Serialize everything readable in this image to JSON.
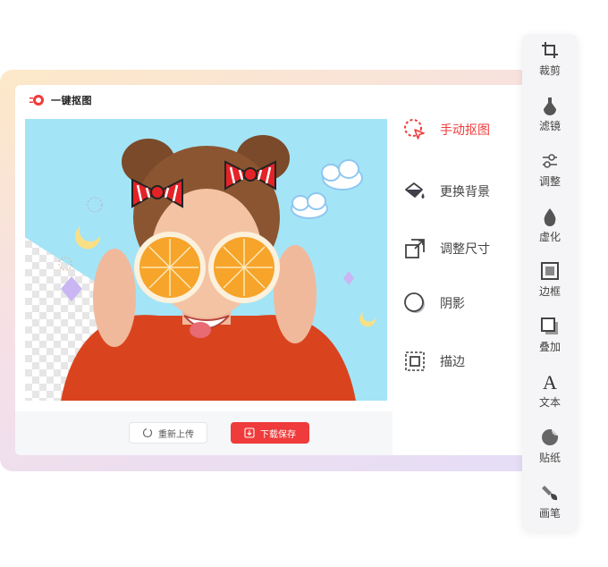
{
  "brand": {
    "name": "一键抠图",
    "logo_icon": "logo-icon"
  },
  "canvas": {
    "image": "woman-with-orange-slices-photo"
  },
  "actions": {
    "reupload_label": "重新上传",
    "download_label": "下载保存"
  },
  "tools": [
    {
      "label": "手动抠图",
      "icon": "manual-cutout-icon",
      "active": true
    },
    {
      "label": "更换背景",
      "icon": "paint-bucket-icon",
      "active": false
    },
    {
      "label": "调整尺寸",
      "icon": "resize-icon",
      "active": false
    },
    {
      "label": "阴影",
      "icon": "shadow-icon",
      "active": false
    },
    {
      "label": "描边",
      "icon": "stroke-icon",
      "active": false
    }
  ],
  "side_toolbar": [
    {
      "label": "裁剪",
      "icon": "crop-icon"
    },
    {
      "label": "滤镜",
      "icon": "filter-icon"
    },
    {
      "label": "调整",
      "icon": "adjust-icon"
    },
    {
      "label": "虚化",
      "icon": "blur-icon"
    },
    {
      "label": "边框",
      "icon": "border-icon"
    },
    {
      "label": "叠加",
      "icon": "overlay-icon"
    },
    {
      "label": "文本",
      "icon": "text-icon"
    },
    {
      "label": "贴纸",
      "icon": "sticker-icon"
    },
    {
      "label": "画笔",
      "icon": "brush-icon"
    }
  ],
  "colors": {
    "accent": "#ef3b3b",
    "canvas_bg": "#a3e4f6",
    "sweater": "#d9441f"
  }
}
